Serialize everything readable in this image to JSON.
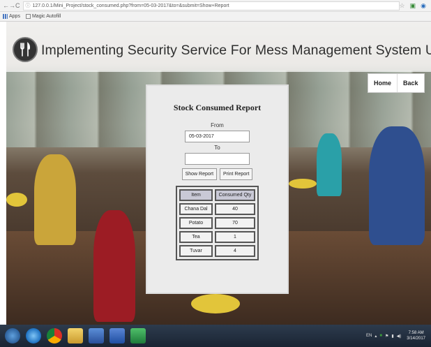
{
  "browser": {
    "url": "127.0.0.1/Mini_Project/stock_consumed.php?from=05-03-2017&to=&submit=Show+Report",
    "bookmarks": [
      "Apps",
      "Magic Autofill"
    ]
  },
  "site": {
    "title": "Implementing Security Service For Mess Management System Using PHP."
  },
  "nav": {
    "home": "Home",
    "back": "Back"
  },
  "report": {
    "title": "Stock Consumed Report",
    "from_label": "From",
    "from_value": "05-03-2017",
    "to_label": "To",
    "to_value": "",
    "show_button": "Show Report",
    "print_button": "Print Report",
    "table": {
      "headers": [
        "Item",
        "Consumed Qty"
      ],
      "rows": [
        [
          "Chana Dal",
          "40"
        ],
        [
          "Potato",
          "70"
        ],
        [
          "Tea",
          "1"
        ],
        [
          "Tuvar",
          "4"
        ]
      ]
    }
  },
  "taskbar": {
    "time": "7:58 AM",
    "date": "3/14/2017"
  }
}
